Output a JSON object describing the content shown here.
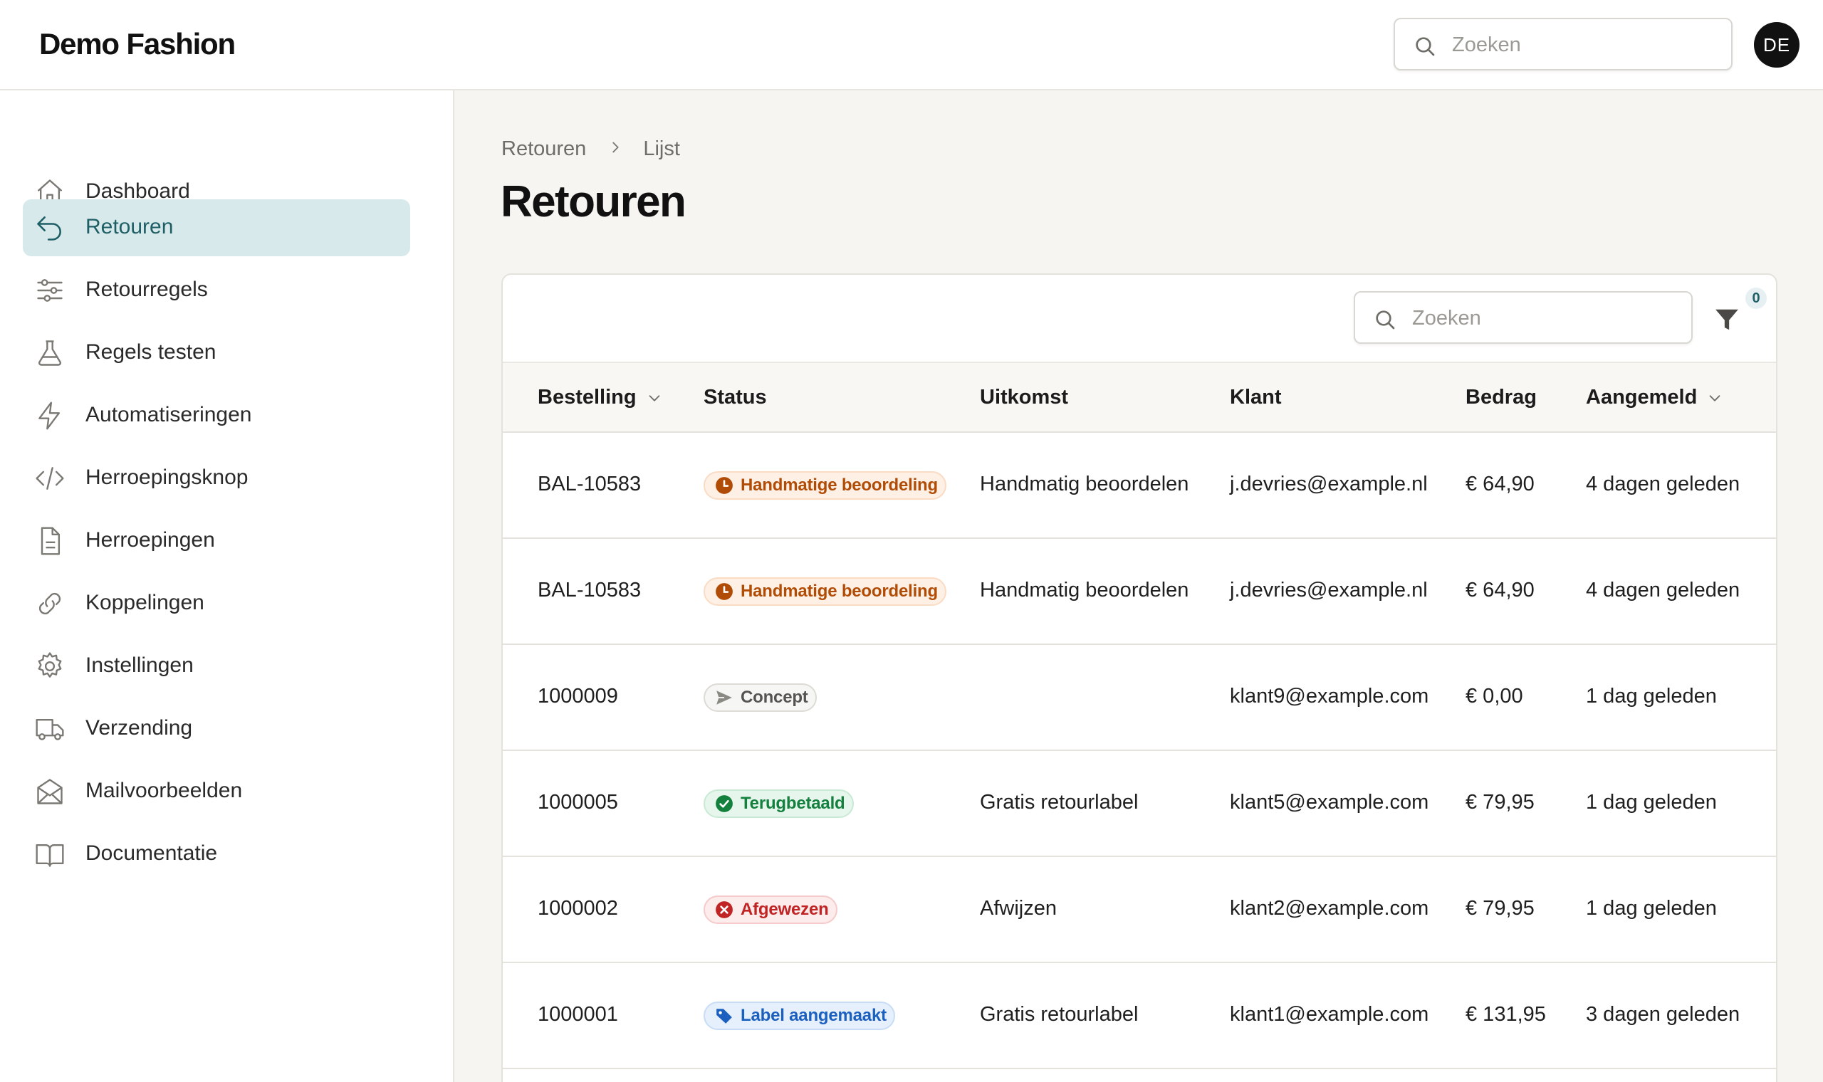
{
  "header": {
    "brand": "Demo Fashion",
    "search_placeholder": "Zoeken",
    "avatar_initials": "DE"
  },
  "sidebar": {
    "items": [
      {
        "label": "Dashboard",
        "icon": "home-icon"
      },
      {
        "label": "Retouren",
        "icon": "return-arrow-icon",
        "active": true
      },
      {
        "label": "Retourregels",
        "icon": "sliders-icon"
      },
      {
        "label": "Regels testen",
        "icon": "flask-icon"
      },
      {
        "label": "Automatiseringen",
        "icon": "lightning-icon"
      },
      {
        "label": "Herroepingsknop",
        "icon": "code-icon"
      },
      {
        "label": "Herroepingen",
        "icon": "document-icon"
      },
      {
        "label": "Koppelingen",
        "icon": "link-icon"
      },
      {
        "label": "Instellingen",
        "icon": "gear-icon"
      },
      {
        "label": "Verzending",
        "icon": "truck-icon"
      },
      {
        "label": "Mailvoorbeelden",
        "icon": "envelope-icon"
      },
      {
        "label": "Documentatie",
        "icon": "book-icon"
      }
    ]
  },
  "breadcrumb": {
    "first": "Retouren",
    "second": "Lijst"
  },
  "page_title": "Retouren",
  "table": {
    "search_placeholder": "Zoeken",
    "filter_count": "0",
    "columns": {
      "order": "Bestelling",
      "status": "Status",
      "outcome": "Uitkomst",
      "customer": "Klant",
      "amount": "Bedrag",
      "registered": "Aangemeld"
    },
    "rows": [
      {
        "order": "BAL-10583",
        "status": "Handmatige beoordeling",
        "status_type": "orange",
        "outcome": "Handmatig beoordelen",
        "customer": "j.devries@example.nl",
        "amount": "€ 64,90",
        "registered": "4 dagen geleden"
      },
      {
        "order": "BAL-10583",
        "status": "Handmatige beoordeling",
        "status_type": "orange",
        "outcome": "Handmatig beoordelen",
        "customer": "j.devries@example.nl",
        "amount": "€ 64,90",
        "registered": "4 dagen geleden"
      },
      {
        "order": "1000009",
        "status": "Concept",
        "status_type": "grey",
        "outcome": "",
        "customer": "klant9@example.com",
        "amount": "€ 0,00",
        "registered": "1 dag geleden"
      },
      {
        "order": "1000005",
        "status": "Terugbetaald",
        "status_type": "green",
        "outcome": "Gratis retourlabel",
        "customer": "klant5@example.com",
        "amount": "€ 79,95",
        "registered": "1 dag geleden"
      },
      {
        "order": "1000002",
        "status": "Afgewezen",
        "status_type": "red",
        "outcome": "Afwijzen",
        "customer": "klant2@example.com",
        "amount": "€ 79,95",
        "registered": "1 dag geleden"
      },
      {
        "order": "1000001",
        "status": "Label aangemaakt",
        "status_type": "blue",
        "outcome": "Gratis retourlabel",
        "customer": "klant1@example.com",
        "amount": "€ 131,95",
        "registered": "3 dagen geleden"
      }
    ]
  },
  "colors": {
    "accent": "#1e5f66",
    "active_nav_bg": "#d8e9ec",
    "status_orange": "#b14c06",
    "status_green": "#14803e",
    "status_red": "#c02424",
    "status_blue": "#1b5fbf",
    "status_grey": "#555450"
  }
}
